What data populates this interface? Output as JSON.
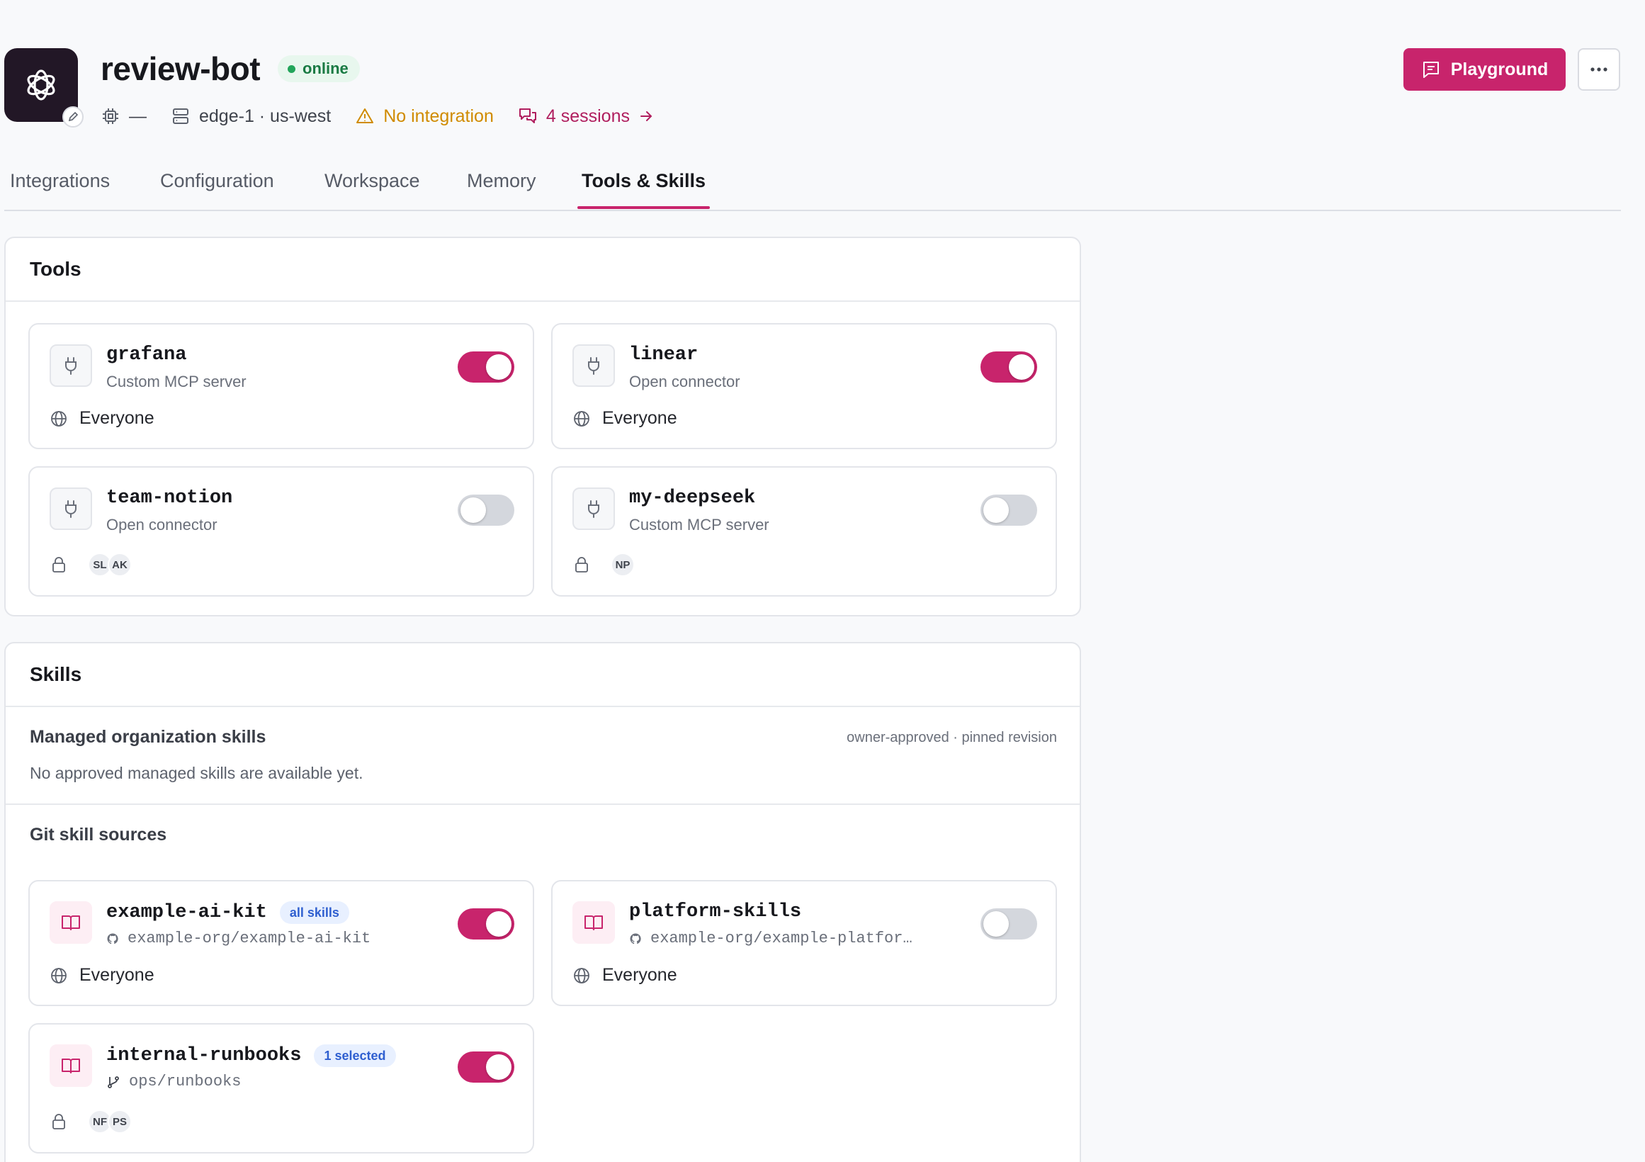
{
  "header": {
    "title": "review-bot",
    "status": "online",
    "model": "—",
    "host": "edge-1 · us-west",
    "integration_warning": "No integration",
    "sessions": "4 sessions",
    "playground_label": "Playground",
    "colors": {
      "accent": "#c8246c",
      "online": "#22a55a",
      "warning": "#d08b00"
    }
  },
  "tabs": [
    {
      "label": "Integrations",
      "active": false
    },
    {
      "label": "Configuration",
      "active": false
    },
    {
      "label": "Workspace",
      "active": false
    },
    {
      "label": "Memory",
      "active": false
    },
    {
      "label": "Tools & Skills",
      "active": true
    }
  ],
  "tools": {
    "title": "Tools",
    "items": [
      {
        "name": "grafana",
        "type": "Custom MCP server",
        "access": "Everyone",
        "enabled": true
      },
      {
        "name": "linear",
        "type": "Open connector",
        "access": "Everyone",
        "enabled": true
      },
      {
        "name": "team-notion",
        "type": "Open connector",
        "users": [
          "SL",
          "AK"
        ],
        "enabled": false
      },
      {
        "name": "my-deepseek",
        "type": "Custom MCP server",
        "users": [
          "NP"
        ],
        "enabled": false
      }
    ]
  },
  "skills": {
    "title": "Skills",
    "managed": {
      "label": "Managed organization skills",
      "note": "owner-approved · pinned revision",
      "empty": "No approved managed skills are available yet."
    },
    "git": {
      "label": "Git skill sources",
      "items": [
        {
          "name": "example-ai-kit",
          "tag": "all skills",
          "repo": "example-org/example-ai-kit",
          "access": "Everyone",
          "enabled": true
        },
        {
          "name": "platform-skills",
          "repo": "example-org/example-platfor…",
          "access": "Everyone",
          "enabled": false
        },
        {
          "name": "internal-runbooks",
          "tag": "1 selected",
          "repo": "ops/runbooks",
          "users": [
            "NF",
            "PS"
          ],
          "enabled": true
        }
      ]
    }
  }
}
